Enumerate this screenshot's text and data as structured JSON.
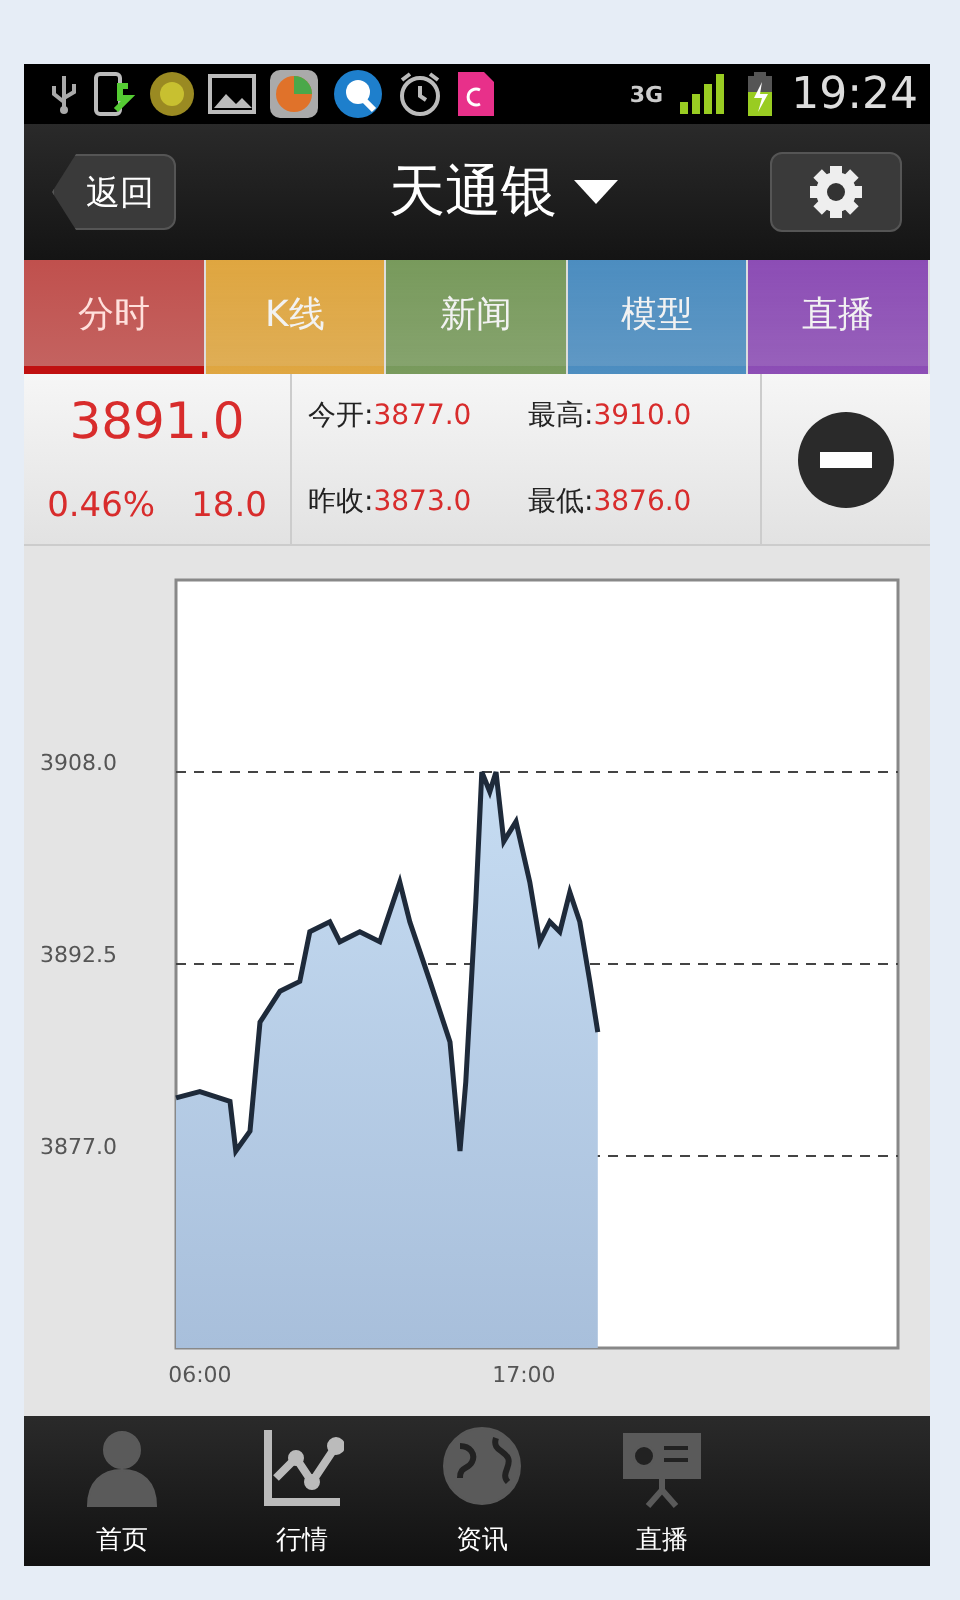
{
  "status_bar": {
    "network": "3G",
    "time": "19:24"
  },
  "header": {
    "back": "返回",
    "title": "天通银"
  },
  "tabs": [
    {
      "label": "分时",
      "selected": true,
      "color": "#c0504d"
    },
    {
      "label": "K线",
      "selected": false,
      "color": "#dfa640"
    },
    {
      "label": "新闻",
      "selected": false,
      "color": "#789a5c"
    },
    {
      "label": "模型",
      "selected": false,
      "color": "#4c8dc0"
    },
    {
      "label": "直播",
      "selected": false,
      "color": "#8c4db5"
    }
  ],
  "quote": {
    "price": "3891.0",
    "change_pct": "0.46%",
    "change": "18.0",
    "stats": [
      {
        "label": "今开:",
        "value": "3877.0"
      },
      {
        "label": "最高:",
        "value": "3910.0"
      },
      {
        "label": "昨收:",
        "value": "3873.0"
      },
      {
        "label": "最低:",
        "value": "3876.0"
      }
    ]
  },
  "chart_data": {
    "type": "area",
    "grid": true,
    "x": [
      5.19,
      6.0,
      7.02,
      7.22,
      7.7,
      8.04,
      8.72,
      9.39,
      9.73,
      10.41,
      10.75,
      11.43,
      12.11,
      12.79,
      13.13,
      13.81,
      14.49,
      14.83,
      15.03,
      15.37,
      15.57,
      15.84,
      16.05,
      16.32,
      16.73,
      17.2,
      17.54,
      17.88,
      18.22,
      18.56,
      18.9,
      19.24,
      19.51
    ],
    "series": [
      {
        "color": "#1e2a3a",
        "values": [
          3881.7,
          3882.2,
          3881.4,
          3877.4,
          3879.0,
          3887.8,
          3890.3,
          3891.1,
          3895.1,
          3895.9,
          3894.3,
          3895.1,
          3894.3,
          3899.1,
          3895.9,
          3891.1,
          3886.2,
          3877.4,
          3883.0,
          3897.5,
          3908.0,
          3906.4,
          3908.0,
          3902.4,
          3904.0,
          3899.1,
          3894.3,
          3895.9,
          3895.1,
          3898.3,
          3895.9,
          3891.1,
          3887.0
        ]
      }
    ],
    "xlim": [
      5.19,
      29.7
    ],
    "ylim": [
      3861.5,
      3923.5
    ],
    "xticks": [
      {
        "value": 6,
        "label": "06:00"
      },
      {
        "value": 17,
        "label": "17:00"
      }
    ],
    "yticks": [
      {
        "value": 3877,
        "label": "3877.0"
      },
      {
        "value": 3892.5,
        "label": "3892.5"
      },
      {
        "value": 3908,
        "label": "3908.0"
      }
    ]
  },
  "nav": [
    {
      "label": "首页",
      "selected": false,
      "kind": "person"
    },
    {
      "label": "行情",
      "selected": true,
      "kind": "chart"
    },
    {
      "label": "资讯",
      "selected": false,
      "kind": "globe"
    },
    {
      "label": "直播",
      "selected": false,
      "kind": "board"
    }
  ]
}
